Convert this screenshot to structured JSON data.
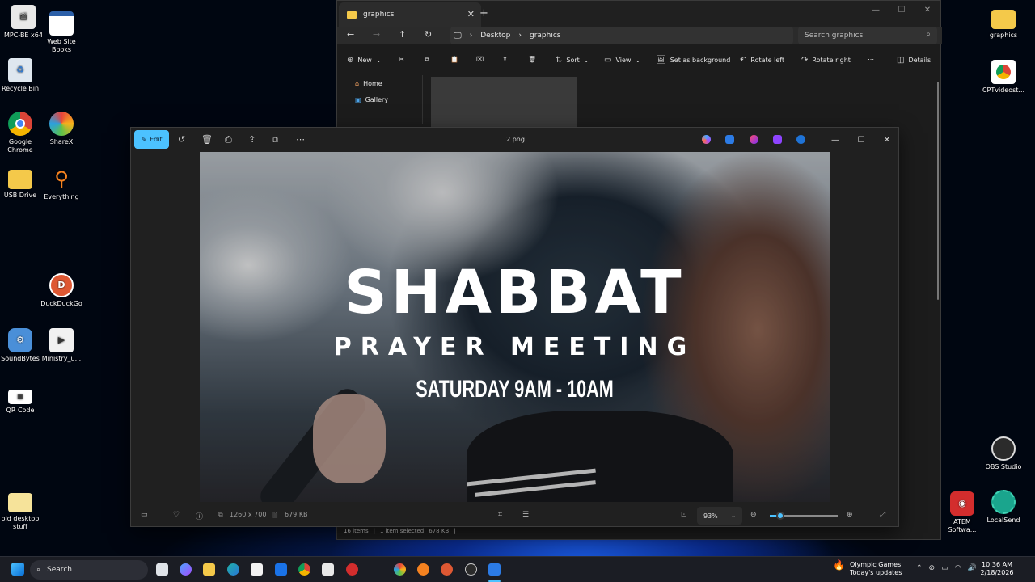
{
  "desktop": {
    "icons_left": [
      {
        "label": "MPC-BE x64",
        "icon": "film-clapper-icon"
      },
      {
        "label": "Web Site Books",
        "icon": "window-app-icon"
      },
      {
        "label": "Recycle Bin",
        "icon": "recycle-bin-icon"
      },
      {
        "label": "Google Chrome",
        "icon": "chrome-icon"
      },
      {
        "label": "ShareX",
        "icon": "sharex-icon"
      },
      {
        "label": "USB Drive",
        "icon": "folder-icon"
      },
      {
        "label": "Everything",
        "icon": "search-magnifier-icon"
      },
      {
        "label": "DuckDuckGo",
        "icon": "duckduckgo-icon"
      },
      {
        "label": "SoundBytes",
        "icon": "gear-robot-icon"
      },
      {
        "label": "Ministry_u...",
        "icon": "media-play-icon"
      },
      {
        "label": "QR Code",
        "icon": "qr-code-icon"
      },
      {
        "label": "old desktop stuff",
        "icon": "folder-icon"
      }
    ],
    "icons_right": [
      {
        "label": "graphics",
        "icon": "folder-icon"
      },
      {
        "label": "CPTvideost...",
        "icon": "chrome-icon"
      },
      {
        "label": "OBS Studio",
        "icon": "obs-icon"
      },
      {
        "label": "ATEM Softwa...",
        "icon": "atem-icon"
      },
      {
        "label": "LocalSend",
        "icon": "localsend-icon"
      }
    ]
  },
  "explorer": {
    "tab_title": "graphics",
    "path": [
      "Desktop",
      "graphics"
    ],
    "search_placeholder": "Search graphics",
    "toolbar": {
      "new": "New",
      "sort": "Sort",
      "view": "View",
      "set_background": "Set as background",
      "rotate_left": "Rotate left",
      "rotate_right": "Rotate right",
      "details": "Details"
    },
    "sidebar": [
      "Home",
      "Gallery"
    ],
    "status": {
      "items": "16 items",
      "selected": "1 item selected",
      "size": "678 KB"
    }
  },
  "photos": {
    "edit_label": "Edit",
    "filename": "2.png",
    "image_text": {
      "title": "SHABBAT",
      "subtitle": "PRAYER MEETING",
      "time": "SATURDAY 9AM - 10AM"
    },
    "info": {
      "dimensions": "1260 x 700",
      "filesize": "679 KB"
    },
    "zoom": "93%",
    "zoom_level": 0.15
  },
  "taskbar": {
    "search_label": "Search",
    "weather_title": "Olympic Games",
    "weather_sub": "Today's updates",
    "time": "10:36 AM",
    "date": "2/18/2026"
  },
  "colors": {
    "accent": "#4cc2ff",
    "folder": "#f4c94a"
  }
}
